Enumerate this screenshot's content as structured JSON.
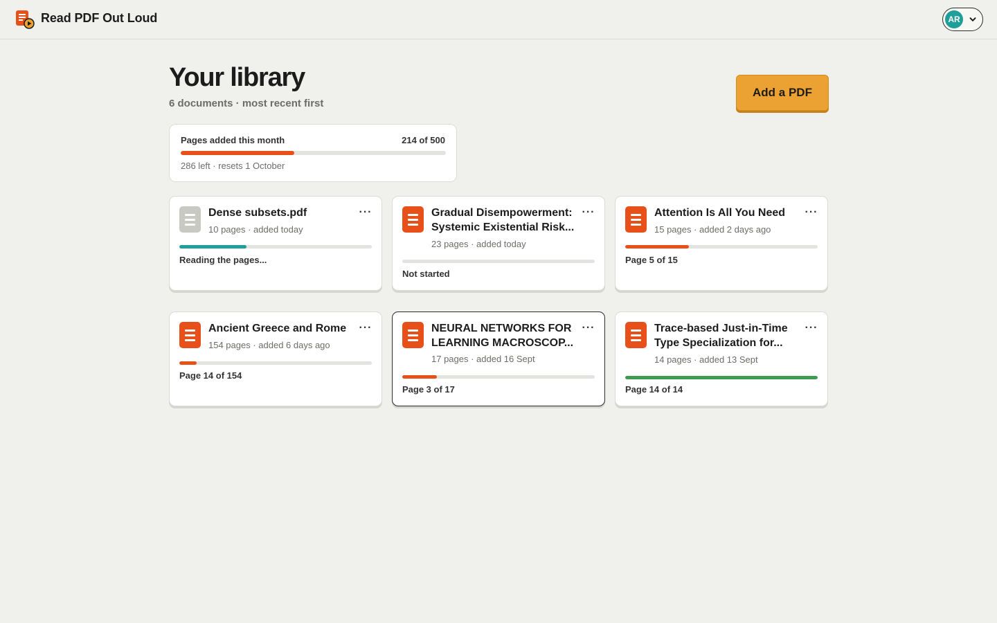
{
  "app": {
    "title": "Read PDF Out Loud",
    "logo_icon": "document-play-icon",
    "brand_color": "#e8501a"
  },
  "account": {
    "initials": "AR",
    "avatar_color": "#1f9e9a",
    "menu_icon": "chevron-down-icon"
  },
  "header": {
    "title": "Your library",
    "subtitle": "6 documents · most recent first",
    "add_button_label": "Add a PDF"
  },
  "quota": {
    "label": "Pages added this month",
    "count_text": "214 of 500",
    "used": 214,
    "limit": 500,
    "note": "286 left · resets 1 October"
  },
  "documents": [
    {
      "title": "Dense subsets.pdf",
      "meta": "10 pages · added today",
      "status": "Reading the pages...",
      "progress": 0.35,
      "progress_color": "#1f9e9a",
      "icon_state": "pending"
    },
    {
      "title": "Gradual Disempowerment: Systemic Existential Risk...",
      "meta": "23 pages · added today",
      "status": "Not started",
      "progress": 0,
      "progress_color": "#e8501a",
      "icon_state": "ready"
    },
    {
      "title": "Attention Is All You Need",
      "meta": "15 pages · added 2 days ago",
      "status": "Page 5 of 15",
      "progress": 0.33,
      "progress_color": "#e8501a",
      "icon_state": "ready"
    },
    {
      "title": "Ancient Greece and Rome",
      "meta": "154 pages · added 6 days ago",
      "status": "Page 14 of 154",
      "progress": 0.09,
      "progress_color": "#e8501a",
      "icon_state": "ready"
    },
    {
      "title": "NEURAL NETWORKS FOR LEARNING MACROSCOP...",
      "meta": "17 pages · added 16 Sept",
      "status": "Page 3 of 17",
      "progress": 0.18,
      "progress_color": "#e8501a",
      "icon_state": "ready"
    },
    {
      "title": "Trace-based Just-in-Time Type Specialization for...",
      "meta": "14 pages · added 13 Sept",
      "status": "Page 14 of 14",
      "progress": 1.0,
      "progress_color": "#3d9a50",
      "icon_state": "ready"
    }
  ]
}
